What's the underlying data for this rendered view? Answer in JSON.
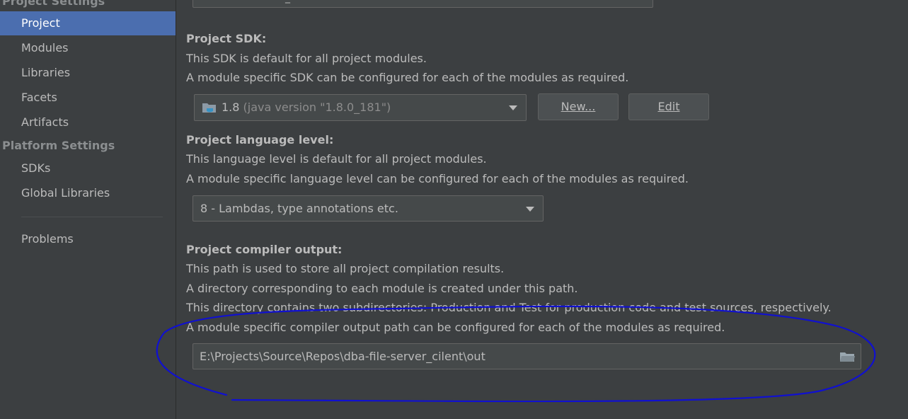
{
  "sidebar": {
    "project_settings_header": "Project Settings",
    "items": [
      {
        "label": "Project",
        "selected": true
      },
      {
        "label": "Modules"
      },
      {
        "label": "Libraries"
      },
      {
        "label": "Facets"
      },
      {
        "label": "Artifacts"
      }
    ],
    "platform_settings_header": "Platform Settings",
    "platform_items": [
      {
        "label": "SDKs"
      },
      {
        "label": "Global Libraries"
      }
    ],
    "problems_label": "Problems"
  },
  "main": {
    "project_name_field_fragment": "_",
    "sdk": {
      "heading": "Project SDK:",
      "desc1": "This SDK is default for all project modules.",
      "desc2": "A module specific SDK can be configured for each of the modules as required.",
      "selected_version": "1.8",
      "selected_detail": "(java version \"1.8.0_181\")",
      "new_button": "New...",
      "edit_button": "Edit"
    },
    "language": {
      "heading": "Project language level:",
      "desc1": "This language level is default for all project modules.",
      "desc2": "A module specific language level can be configured for each of the modules as required.",
      "selected": "8 - Lambdas, type annotations etc."
    },
    "compiler": {
      "heading": "Project compiler output:",
      "desc1": "This path is used to store all project compilation results.",
      "desc2": "A directory corresponding to each module is created under this path.",
      "desc3": "This directory contains two subdirectories: Production and Test for production code and test sources, respectively.",
      "desc4": "A module specific compiler output path can be configured for each of the modules as required.",
      "path": "E:\\Projects\\Source\\Repos\\dba-file-server_cilent\\out"
    }
  },
  "colors": {
    "background": "#3c3f41",
    "selection": "#4b6eaf",
    "annotation": "#1010d0"
  }
}
